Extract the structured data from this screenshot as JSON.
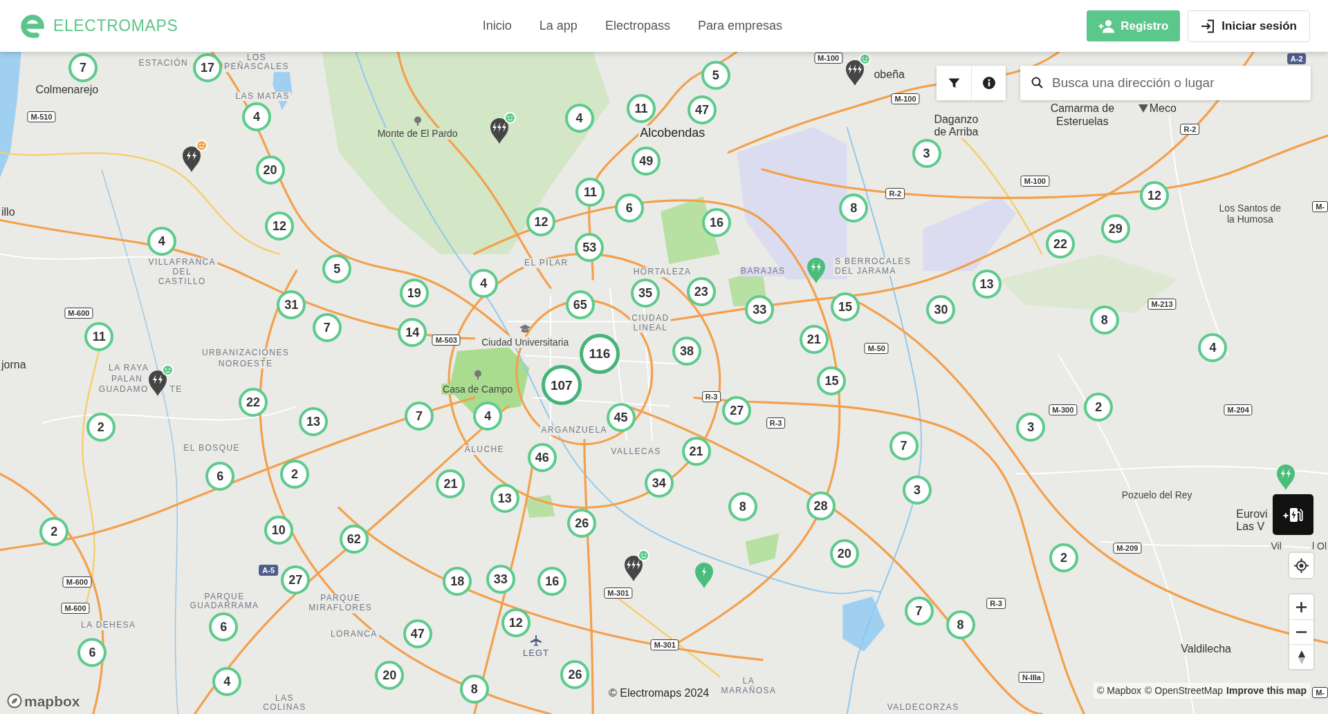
{
  "header": {
    "brand": "ELECTROMAPS",
    "nav": [
      {
        "label": "Inicio"
      },
      {
        "label": "La app"
      },
      {
        "label": "Electropass"
      },
      {
        "label": "Para empresas"
      }
    ],
    "register_button": "Registro",
    "login_button": "Iniciar sesión"
  },
  "map": {
    "search": {
      "placeholder": "Busca una dirección o lugar"
    },
    "clusters": [
      {
        "count": "7",
        "kind": "small"
      },
      {
        "count": "17",
        "kind": "small"
      },
      {
        "count": "4",
        "kind": "small"
      },
      {
        "count": "20",
        "kind": "small"
      },
      {
        "count": "12",
        "kind": "small"
      },
      {
        "count": "4",
        "kind": "small"
      },
      {
        "count": "5",
        "kind": "small"
      },
      {
        "count": "31",
        "kind": "small"
      },
      {
        "count": "7",
        "kind": "small"
      },
      {
        "count": "11",
        "kind": "small"
      },
      {
        "count": "19",
        "kind": "small"
      },
      {
        "count": "14",
        "kind": "small"
      },
      {
        "count": "4",
        "kind": "small"
      },
      {
        "count": "53",
        "kind": "small"
      },
      {
        "count": "12",
        "kind": "small"
      },
      {
        "count": "11",
        "kind": "small"
      },
      {
        "count": "6",
        "kind": "small"
      },
      {
        "count": "49",
        "kind": "small"
      },
      {
        "count": "4",
        "kind": "small"
      },
      {
        "count": "11",
        "kind": "small"
      },
      {
        "count": "47",
        "kind": "small"
      },
      {
        "count": "5",
        "kind": "small"
      },
      {
        "count": "16",
        "kind": "small"
      },
      {
        "count": "65",
        "kind": "small"
      },
      {
        "count": "35",
        "kind": "small"
      },
      {
        "count": "23",
        "kind": "small"
      },
      {
        "count": "116",
        "kind": "large"
      },
      {
        "count": "38",
        "kind": "small"
      },
      {
        "count": "33",
        "kind": "small"
      },
      {
        "count": "15",
        "kind": "small"
      },
      {
        "count": "21",
        "kind": "small"
      },
      {
        "count": "15",
        "kind": "small"
      },
      {
        "count": "8",
        "kind": "small"
      },
      {
        "count": "3",
        "kind": "small"
      },
      {
        "count": "22",
        "kind": "small"
      },
      {
        "count": "29",
        "kind": "small"
      },
      {
        "count": "12",
        "kind": "small"
      },
      {
        "count": "13",
        "kind": "small"
      },
      {
        "count": "30",
        "kind": "small"
      },
      {
        "count": "8",
        "kind": "small"
      },
      {
        "count": "4",
        "kind": "small"
      },
      {
        "count": "107",
        "kind": "large"
      },
      {
        "count": "45",
        "kind": "small"
      },
      {
        "count": "27",
        "kind": "small"
      },
      {
        "count": "21",
        "kind": "small"
      },
      {
        "count": "22",
        "kind": "small"
      },
      {
        "count": "13",
        "kind": "small"
      },
      {
        "count": "7",
        "kind": "small"
      },
      {
        "count": "4",
        "kind": "small"
      },
      {
        "count": "2",
        "kind": "small"
      },
      {
        "count": "46",
        "kind": "small"
      },
      {
        "count": "21",
        "kind": "small"
      },
      {
        "count": "13",
        "kind": "small"
      },
      {
        "count": "34",
        "kind": "small"
      },
      {
        "count": "8",
        "kind": "small"
      },
      {
        "count": "28",
        "kind": "small"
      },
      {
        "count": "7",
        "kind": "small"
      },
      {
        "count": "3",
        "kind": "small"
      },
      {
        "count": "3",
        "kind": "small"
      },
      {
        "count": "2",
        "kind": "small"
      },
      {
        "count": "6",
        "kind": "small"
      },
      {
        "count": "2",
        "kind": "small"
      },
      {
        "count": "2",
        "kind": "small"
      },
      {
        "count": "10",
        "kind": "small"
      },
      {
        "count": "62",
        "kind": "small"
      },
      {
        "count": "26",
        "kind": "small"
      },
      {
        "count": "20",
        "kind": "small"
      },
      {
        "count": "2",
        "kind": "small"
      },
      {
        "count": "27",
        "kind": "small"
      },
      {
        "count": "18",
        "kind": "small"
      },
      {
        "count": "33",
        "kind": "small"
      },
      {
        "count": "16",
        "kind": "small"
      },
      {
        "count": "12",
        "kind": "small"
      },
      {
        "count": "47",
        "kind": "small"
      },
      {
        "count": "6",
        "kind": "small"
      },
      {
        "count": "6",
        "kind": "small"
      },
      {
        "count": "7",
        "kind": "small"
      },
      {
        "count": "8",
        "kind": "small"
      },
      {
        "count": "20",
        "kind": "small"
      },
      {
        "count": "26",
        "kind": "small"
      },
      {
        "count": "8",
        "kind": "small"
      },
      {
        "count": "4",
        "kind": "small"
      }
    ],
    "chargers": [
      {
        "color": "#454545",
        "badge": {
          "color": "#f3a64c"
        }
      },
      {
        "color": "#454545",
        "badge": {
          "color": "#5dca8b"
        }
      },
      {
        "color": "#454545",
        "badge": {
          "color": "#5dca8b"
        }
      },
      {
        "color": "#4bbd7b"
      },
      {
        "color": "#454545",
        "badge": {
          "color": "#5dca8b"
        }
      },
      {
        "color": "#454545",
        "badge": {
          "color": "#5dca8b"
        }
      },
      {
        "color": "#4bbd7b"
      },
      {
        "color": "#4bbd7b"
      }
    ],
    "places": [
      {
        "kind": "district",
        "lines": [
          "ESTACIÓN"
        ]
      },
      {
        "kind": "district",
        "lines": [
          "LOS",
          "PEÑASCALES"
        ]
      },
      {
        "kind": "town",
        "lines": [
          "obeña"
        ]
      },
      {
        "kind": "town",
        "lines": [
          "Colmenarejo"
        ]
      },
      {
        "kind": "district",
        "lines": [
          "LAS MATAS"
        ]
      },
      {
        "kind": "town",
        "lines": [
          "Camarma de"
        ]
      },
      {
        "kind": "town",
        "lines": [
          "Meco"
        ]
      },
      {
        "kind": "town",
        "lines": [
          "Daganzo"
        ]
      },
      {
        "kind": "town",
        "lines": [
          "Esteruelas"
        ]
      },
      {
        "kind": "small",
        "lines": [
          "Monte de El Pardo"
        ]
      },
      {
        "kind": "city",
        "lines": [
          "Alcobendas"
        ]
      },
      {
        "kind": "town",
        "lines": [
          "de Arriba"
        ]
      },
      {
        "kind": "town",
        "lines": [
          "illo"
        ]
      },
      {
        "kind": "small",
        "lines": [
          "Los Santos de",
          "la Humosa"
        ]
      },
      {
        "kind": "district",
        "lines": [
          "VILLAFRANCA",
          "DEL",
          "CASTILLO"
        ]
      },
      {
        "kind": "district",
        "lines": [
          "EL PILAR"
        ]
      },
      {
        "kind": "district",
        "lines": [
          "HORTALEZA"
        ]
      },
      {
        "kind": "district",
        "lines": [
          "BARAJAS"
        ]
      },
      {
        "kind": "district",
        "lines": [
          "S BERROCALES",
          "DEL JARAMA"
        ]
      },
      {
        "kind": "district",
        "lines": [
          "CIUDAD",
          "LINEAL"
        ]
      },
      {
        "kind": "small",
        "lines": [
          "Ciudad Universitaria"
        ]
      },
      {
        "kind": "district",
        "lines": [
          "URBANIZACIONES"
        ]
      },
      {
        "kind": "town",
        "lines": [
          "jorna"
        ]
      },
      {
        "kind": "district",
        "lines": [
          "LA RAYA"
        ]
      },
      {
        "kind": "district",
        "lines": [
          "NOROESTE"
        ]
      },
      {
        "kind": "district",
        "lines": [
          "PALAN"
        ]
      },
      {
        "kind": "district",
        "lines": [
          "GUADAMO"
        ]
      },
      {
        "kind": "district",
        "lines": [
          "TE"
        ]
      },
      {
        "kind": "small",
        "lines": [
          "Casa de Campo"
        ]
      },
      {
        "kind": "district",
        "lines": [
          "ARGANZUELA"
        ]
      },
      {
        "kind": "district",
        "lines": [
          "EL BOSQUE"
        ]
      },
      {
        "kind": "district",
        "lines": [
          "ALUCHE"
        ]
      },
      {
        "kind": "district",
        "lines": [
          "VALLECAS"
        ]
      },
      {
        "kind": "small",
        "lines": [
          "Pozuelo del Rey"
        ]
      },
      {
        "kind": "town",
        "lines": [
          "Eurovi",
          "Las V"
        ]
      },
      {
        "kind": "small",
        "lines": [
          "Vil"
        ]
      },
      {
        "kind": "small",
        "lines": [
          "l Ol"
        ]
      },
      {
        "kind": "district",
        "lines": [
          "PARQUE",
          "GUADARRAMA"
        ]
      },
      {
        "kind": "district",
        "lines": [
          "PARQUE",
          "MIRAFLORES"
        ]
      },
      {
        "kind": "district",
        "lines": [
          "LA DEHESA"
        ]
      },
      {
        "kind": "district",
        "lines": [
          "LORANCA"
        ]
      },
      {
        "kind": "airport",
        "lines": [
          "LEGT"
        ]
      },
      {
        "kind": "town",
        "lines": [
          "Valdilecha"
        ]
      },
      {
        "kind": "district",
        "lines": [
          "LA",
          "MARAÑOSA"
        ]
      },
      {
        "kind": "district",
        "lines": [
          "LAS",
          "COLINAS"
        ]
      },
      {
        "kind": "district",
        "lines": [
          "VALDECORZAS"
        ]
      }
    ],
    "roads": [
      {
        "ref": "M-100",
        "kind": "regional"
      },
      {
        "ref": "A-2",
        "kind": "national"
      },
      {
        "ref": "M-100",
        "kind": "regional"
      },
      {
        "ref": "M-510",
        "kind": "regional"
      },
      {
        "ref": "R-2",
        "kind": "regional"
      },
      {
        "ref": "M-100",
        "kind": "regional"
      },
      {
        "ref": "R-2",
        "kind": "regional"
      },
      {
        "ref": "M-",
        "kind": "regional"
      },
      {
        "ref": "M-213",
        "kind": "regional"
      },
      {
        "ref": "M-600",
        "kind": "regional"
      },
      {
        "ref": "M-503",
        "kind": "regional"
      },
      {
        "ref": "M-50",
        "kind": "regional"
      },
      {
        "ref": "R-3",
        "kind": "regional"
      },
      {
        "ref": "M-300",
        "kind": "regional"
      },
      {
        "ref": "M-204",
        "kind": "regional"
      },
      {
        "ref": "R-3",
        "kind": "regional"
      },
      {
        "ref": "M-209",
        "kind": "regional"
      },
      {
        "ref": "A-5",
        "kind": "national"
      },
      {
        "ref": "M-600",
        "kind": "regional"
      },
      {
        "ref": "M-301",
        "kind": "regional"
      },
      {
        "ref": "M-600",
        "kind": "regional"
      },
      {
        "ref": "R-3",
        "kind": "regional"
      },
      {
        "ref": "M-301",
        "kind": "regional"
      },
      {
        "ref": "N-IIIa",
        "kind": "regional"
      },
      {
        "ref": "M-",
        "kind": "regional"
      }
    ],
    "mapbox_logo": "mapbox",
    "copyright": "© Electromaps 2024",
    "attribution": [
      {
        "label": "© Mapbox",
        "kind": "credit"
      },
      {
        "label": "© OpenStreetMap",
        "kind": "credit"
      },
      {
        "label": "Improve this map",
        "kind": "feedback"
      }
    ]
  }
}
